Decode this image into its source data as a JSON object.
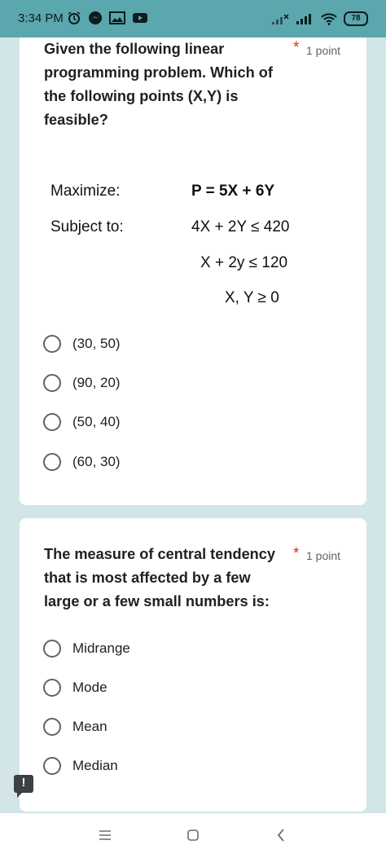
{
  "status_bar": {
    "time": "3:34 PM",
    "battery": "78"
  },
  "question1": {
    "text": "Given the following linear\nprogramming problem. Which of\nthe following points (X,Y) is\nfeasible?",
    "required": "*",
    "points": "1 point",
    "image": {
      "maximize_label": "Maximize:",
      "objective": "P = 5X + 6Y",
      "subject_label": "Subject to:",
      "constraint1": "4X + 2Y  ≤ 420",
      "constraint2": "X + 2y  ≤ 120",
      "constraint3": "X, Y  ≥  0"
    },
    "options": [
      "(30, 50)",
      "(90, 20)",
      "(50, 40)",
      "(60, 30)"
    ]
  },
  "question2": {
    "text": "The measure of central tendency\nthat is most affected by a few\nlarge or a few small numbers is:",
    "required": "*",
    "points": "1 point",
    "options": [
      "Midrange",
      "Mode",
      "Mean",
      "Median"
    ]
  },
  "nav": {
    "feedback_icon": "!"
  }
}
